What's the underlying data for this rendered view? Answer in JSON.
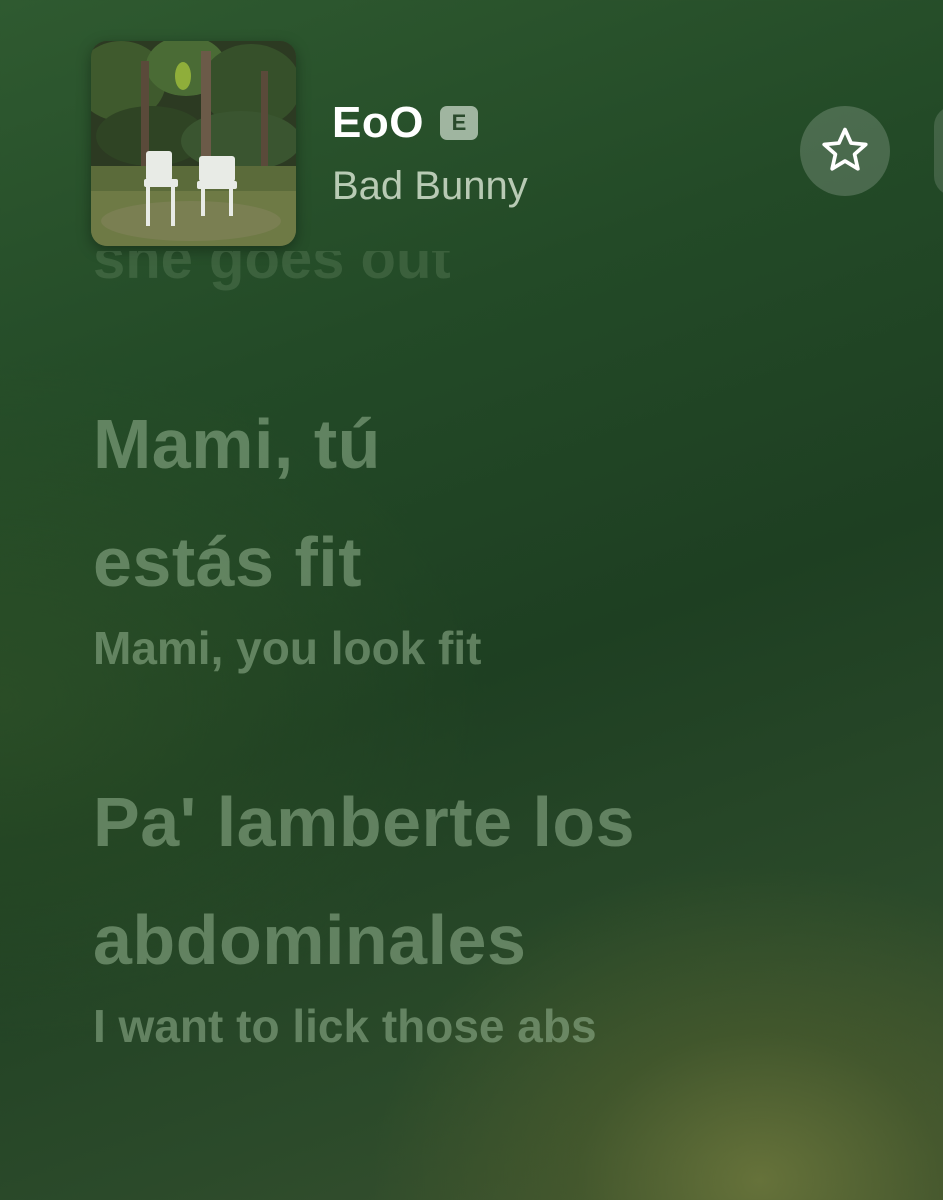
{
  "now_playing": {
    "title": "EoO",
    "explicit_badge": "E",
    "artist": "Bad Bunny",
    "favorite_icon": "star-outline-icon"
  },
  "lyrics": {
    "previous_line_fragment": "she goes out",
    "blocks": [
      {
        "original_line_1": "Mami, tú",
        "original_line_2": "estás fit",
        "translation": "Mami, you look fit"
      },
      {
        "original_line_1": "Pa' lamberte los",
        "original_line_2": "abdominales",
        "translation": "I want to lick those abs"
      }
    ]
  },
  "colors": {
    "background_dark_green": "#1e3f22",
    "lyric_text": "#96b491",
    "title_text": "#ffffff"
  }
}
